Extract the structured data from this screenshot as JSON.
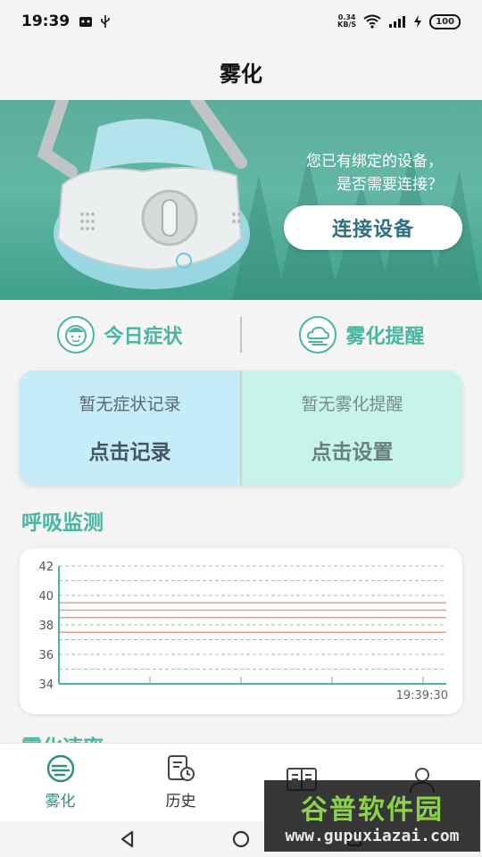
{
  "status_bar": {
    "time": "19:39",
    "net_speed_value": "0.34",
    "net_speed_unit": "KB/S",
    "battery": "100"
  },
  "header": {
    "title": "雾化"
  },
  "banner": {
    "line1": "您已有绑定的设备，",
    "line2": "是否需要连接？",
    "connect_button": "连接设备"
  },
  "tabs": [
    {
      "label": "今日症状",
      "icon": "face-icon"
    },
    {
      "label": "雾化提醒",
      "icon": "cloud-icon"
    }
  ],
  "cards": {
    "symptom": {
      "status": "暂无症状记录",
      "action": "点击记录"
    },
    "reminder": {
      "status": "暂无雾化提醒",
      "action": "点击设置"
    }
  },
  "breathing": {
    "title": "呼吸监测",
    "time_label": "19:39:30"
  },
  "next_section_title": "雾化速率",
  "chart_data": {
    "type": "line",
    "title": "",
    "xlabel": "",
    "ylabel": "",
    "ylim": [
      34,
      42
    ],
    "yticks": [
      34,
      36,
      38,
      40,
      42
    ],
    "x_tick_labels": [
      "19:39:30"
    ],
    "reference_lines": [
      39.5,
      39,
      38.5,
      37.5
    ],
    "series": [],
    "grid": true,
    "accent": "#49b6a3",
    "reference_color": "#f29a8a"
  },
  "bottom_nav": [
    {
      "label": "雾化",
      "icon": "nebulizer-icon",
      "active": true
    },
    {
      "label": "历史",
      "icon": "history-icon",
      "active": false
    },
    {
      "label": "",
      "icon": "book-icon",
      "active": false
    },
    {
      "label": "",
      "icon": "profile-icon",
      "active": false
    }
  ],
  "watermark": {
    "main": "谷普软件园",
    "sub": "www.gupuxiazai.com"
  },
  "colors": {
    "accent": "#49b6a3",
    "banner": "#5cae9c",
    "card_left": "#c6ecfa",
    "card_right": "#c6f3ea"
  }
}
